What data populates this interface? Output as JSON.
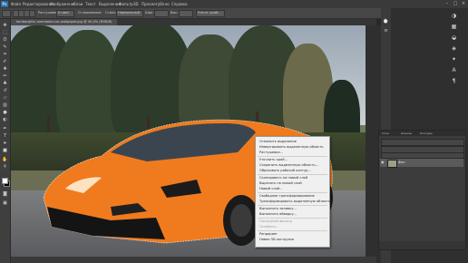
{
  "app": {
    "logo": "Ps",
    "menu": [
      "Файл",
      "Редактирование",
      "Изображение",
      "Слои",
      "Текст",
      "Выделение",
      "Фильтр",
      "3D",
      "Просмотр",
      "Окно",
      "Справка"
    ]
  },
  "options_bar": {
    "labels": [
      "Растушевка:",
      "0 пикс",
      "Сглаживание",
      "Стиль:",
      "Нормальный",
      "Шир.:",
      "Выс.:",
      "Уточн. край..."
    ]
  },
  "document": {
    "tab_title": "lamborghini-aventador-car-wallpaper.jpg @ 45,4% (RGB/8)"
  },
  "layers_panel": {
    "tabs": [
      "Слои",
      "Каналы",
      "Контуры"
    ],
    "layer_name": "Фон"
  },
  "context_menu": {
    "items": [
      {
        "label": "Отменить выделение",
        "disabled": false
      },
      {
        "label": "Инвертировать выделенную область",
        "disabled": false
      },
      {
        "label": "Растушевка...",
        "disabled": false
      },
      {
        "label": "Уточнить край...",
        "disabled": false
      },
      {
        "label": "Сохранить выделенную область...",
        "disabled": false
      },
      {
        "label": "Образовать рабочий контур...",
        "disabled": false
      },
      {
        "label": "Скопировать на новый слой",
        "disabled": false
      },
      {
        "label": "Вырезать на новый слой",
        "disabled": false
      },
      {
        "label": "Новый слой...",
        "disabled": false
      },
      {
        "label": "Свободное трансформирование",
        "disabled": false
      },
      {
        "label": "Трансформировать выделенную область",
        "disabled": false
      },
      {
        "label": "Выполнить заливку...",
        "disabled": false
      },
      {
        "label": "Выполнить обводку...",
        "disabled": false
      },
      {
        "label": "Последний фильтр",
        "disabled": true
      },
      {
        "label": "Ослабить...",
        "disabled": true
      },
      {
        "label": "Рендеринг",
        "disabled": false
      },
      {
        "label": "Новая 3D-экструзия",
        "disabled": false
      }
    ]
  },
  "colors": {
    "canvas_bg": "#282828",
    "menu_bg": "#3a3a3a",
    "car_orange": "#f07b1e",
    "ps_blue": "#2a6ea8"
  }
}
